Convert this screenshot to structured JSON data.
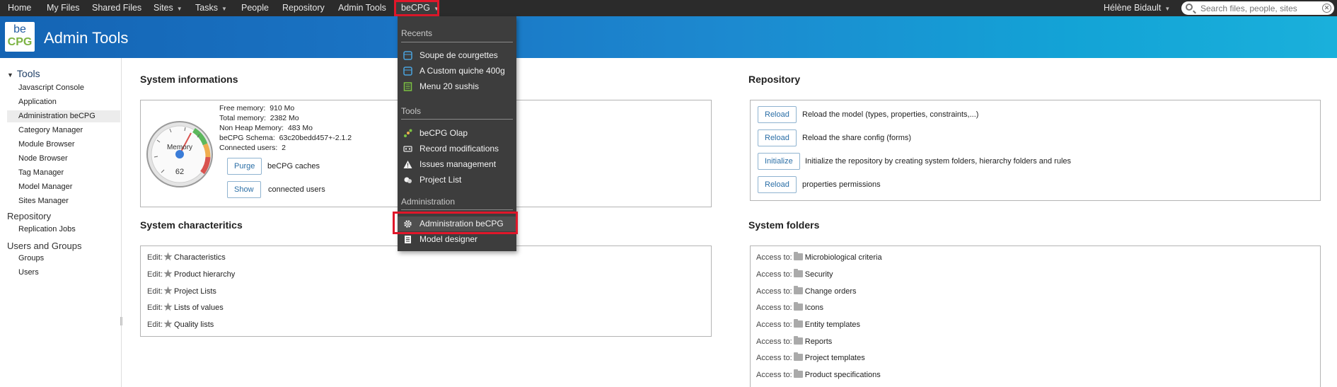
{
  "topnav": {
    "items": [
      {
        "label": "Home"
      },
      {
        "label": "My Files"
      },
      {
        "label": "Shared Files"
      },
      {
        "label": "Sites"
      },
      {
        "label": "Tasks"
      },
      {
        "label": "People"
      },
      {
        "label": "Repository"
      },
      {
        "label": "Admin Tools"
      },
      {
        "label": "beCPG"
      }
    ],
    "user": "Hélène Bidault",
    "search_placeholder": "Search files, people, sites"
  },
  "header": {
    "logo_top": "be",
    "logo_bottom": "CPG",
    "title": "Admin Tools"
  },
  "sidebar": {
    "tools_heading": "Tools",
    "tools_items": [
      {
        "label": "Javascript Console"
      },
      {
        "label": "Application"
      },
      {
        "label": "Administration beCPG"
      },
      {
        "label": "Category Manager"
      },
      {
        "label": "Module Browser"
      },
      {
        "label": "Node Browser"
      },
      {
        "label": "Tag Manager"
      },
      {
        "label": "Model Manager"
      },
      {
        "label": "Sites Manager"
      }
    ],
    "repository_heading": "Repository",
    "repository_items": [
      {
        "label": "Replication Jobs"
      }
    ],
    "users_heading": "Users and Groups",
    "users_items": [
      {
        "label": "Groups"
      },
      {
        "label": "Users"
      }
    ]
  },
  "system_info": {
    "title": "System informations",
    "gauge_label": "Memory",
    "gauge_value": "62",
    "rows": [
      {
        "label": "Free memory:",
        "value": "910 Mo"
      },
      {
        "label": "Total memory:",
        "value": "2382 Mo"
      },
      {
        "label": "Non Heap Memory:",
        "value": "483 Mo"
      },
      {
        "label": "beCPG Schema:",
        "value": "63c20bedd457+-2.1.2"
      },
      {
        "label": "Connected users:",
        "value": "2"
      }
    ],
    "purge_label": "Purge",
    "purge_desc": "beCPG caches",
    "show_label": "Show",
    "show_desc": "connected users"
  },
  "system_characteristics": {
    "title": "System characteritics",
    "prefix": "Edit:",
    "items": [
      {
        "label": "Characteristics"
      },
      {
        "label": "Product hierarchy"
      },
      {
        "label": "Project Lists"
      },
      {
        "label": "Lists of values"
      },
      {
        "label": "Quality lists"
      }
    ]
  },
  "repository": {
    "title": "Repository",
    "actions": [
      {
        "button": "Reload",
        "desc": "Reload the model (types, properties, constraints,...)"
      },
      {
        "button": "Reload",
        "desc": "Reload the share config (forms)"
      },
      {
        "button": "Initialize",
        "desc": "Initialize the repository by creating system folders, hierarchy folders and rules"
      },
      {
        "button": "Reload",
        "desc": "properties permissions"
      }
    ]
  },
  "system_folders": {
    "title": "System folders",
    "prefix": "Access to:",
    "items": [
      {
        "label": "Microbiological criteria"
      },
      {
        "label": "Security"
      },
      {
        "label": "Change orders"
      },
      {
        "label": "Icons"
      },
      {
        "label": "Entity templates"
      },
      {
        "label": "Reports"
      },
      {
        "label": "Project templates"
      },
      {
        "label": "Product specifications"
      }
    ]
  },
  "dropdown": {
    "recents_heading": "Recents",
    "recents": [
      {
        "label": "Soupe de courgettes",
        "icon": "product-icon"
      },
      {
        "label": "A Custom quiche 400g",
        "icon": "product-icon"
      },
      {
        "label": "Menu 20 sushis",
        "icon": "menu-icon"
      }
    ],
    "tools_heading": "Tools",
    "tools": [
      {
        "label": "beCPG Olap",
        "icon": "olap-icon"
      },
      {
        "label": "Record modifications",
        "icon": "record-icon"
      },
      {
        "label": "Issues management",
        "icon": "warning-icon"
      },
      {
        "label": "Project List",
        "icon": "project-icon"
      }
    ],
    "admin_heading": "Administration",
    "admin": [
      {
        "label": "Administration beCPG",
        "icon": "gear-icon"
      },
      {
        "label": "Model designer",
        "icon": "model-icon"
      }
    ]
  },
  "colors": {
    "highlight": "#e0172a",
    "header_start": "#1464b4",
    "header_end": "#1ab0db",
    "button_text": "#2a6ea6"
  }
}
